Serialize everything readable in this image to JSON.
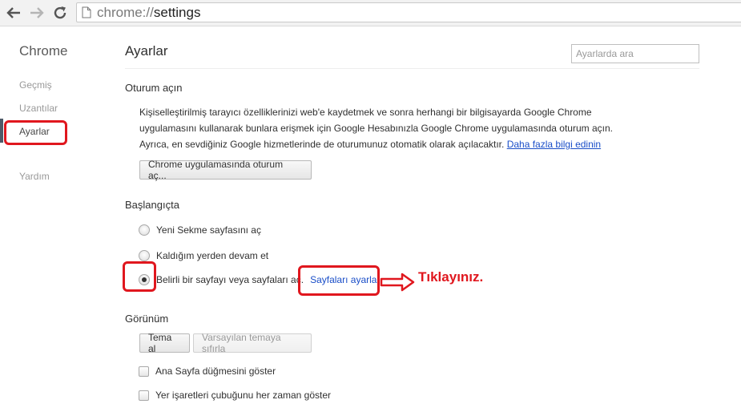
{
  "browser": {
    "url_scheme": "chrome://",
    "url_path": "settings"
  },
  "sidebar": {
    "title": "Chrome",
    "items": [
      {
        "label": "Geçmiş"
      },
      {
        "label": "Uzantılar"
      },
      {
        "label": "Ayarlar",
        "selected": true
      },
      {
        "label": "Yardım"
      }
    ]
  },
  "header": {
    "title": "Ayarlar",
    "search_placeholder": "Ayarlarda ara"
  },
  "signin": {
    "title": "Oturum açın",
    "line1": "Kişiselleştirilmiş tarayıcı özelliklerinizi web'e kaydetmek ve sonra herhangi bir bilgisayarda Google Chrome",
    "line2": "uygulamasını kullanarak bunlara erişmek için Google Hesabınızla Google Chrome uygulamasında oturum açın.",
    "line3": "Ayrıca, en sevdiğiniz Google hizmetlerinde de oturumunuz otomatik olarak açılacaktır.",
    "learn_more": "Daha fazla bilgi edinin",
    "button": "Chrome uygulamasında oturum aç..."
  },
  "startup": {
    "title": "Başlangıçta",
    "options": [
      {
        "label": "Yeni Sekme sayfasını aç",
        "checked": false
      },
      {
        "label": "Kaldığım yerden devam et",
        "checked": false
      },
      {
        "label": "Belirli bir sayfayı veya sayfaları aç.",
        "checked": true
      }
    ],
    "set_pages_link": "Sayfaları ayarla"
  },
  "appearance": {
    "title": "Görünüm",
    "get_themes": "Tema al",
    "reset_theme": "Varsayılan temaya sıfırla",
    "checkboxes": [
      {
        "label": "Ana Sayfa düğmesini göster",
        "checked": false
      },
      {
        "label": "Yer işaretleri çubuğunu her zaman göster",
        "checked": false
      }
    ]
  },
  "annotation": {
    "text": "Tıklayınız.",
    "color": "#e0171e"
  }
}
